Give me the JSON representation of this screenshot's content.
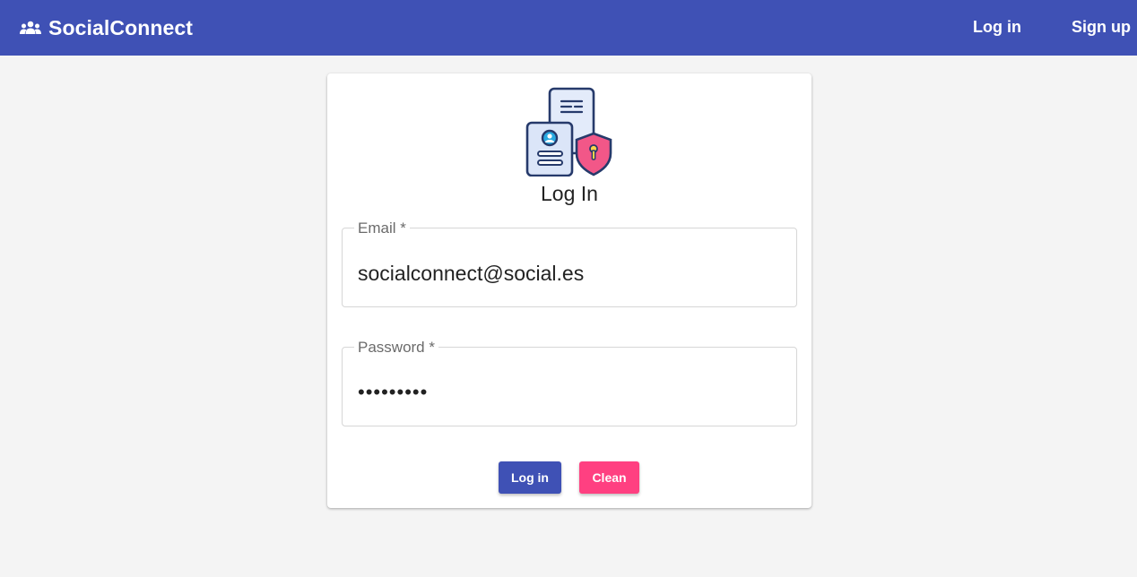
{
  "navbar": {
    "brand": "SocialConnect",
    "brand_icon": "group-icon",
    "links": [
      "Log in",
      "Sign up"
    ],
    "color": "#3f51b5"
  },
  "login_card": {
    "illustration": "document-shield-icon",
    "title": "Log In",
    "email": {
      "label": "Email *",
      "value": "socialconnect@social.es"
    },
    "password": {
      "label": "Password *",
      "value": "•••••••••"
    },
    "buttons": {
      "login": "Log in",
      "clean": "Clean"
    },
    "colors": {
      "primary": "#3f51b5",
      "accent": "#ff4081"
    }
  }
}
